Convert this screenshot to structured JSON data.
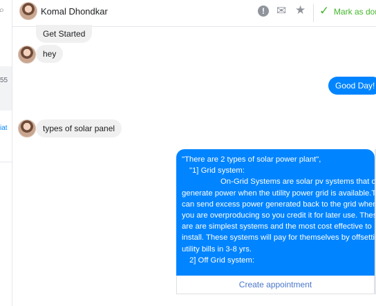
{
  "left_panel": {
    "partial_text_1": "55",
    "partial_text_2": "iat"
  },
  "header": {
    "contact_name": "Komal Dhondkar",
    "alert_icon": "alert-icon",
    "mail_icon": "envelope-icon",
    "star_icon": "star-icon",
    "mark_done_label": "Mark as dor",
    "accent_color": "#42b72a"
  },
  "messages": [
    {
      "direction": "in",
      "text": "Get Started"
    },
    {
      "direction": "in",
      "text": "hey"
    },
    {
      "direction": "out",
      "text": "Good Day!"
    },
    {
      "direction": "in",
      "text": "types of solar panel"
    }
  ],
  "solar_card": {
    "lines": [
      "\"There are 2 types of solar power plant\",",
      "\"1]   Grid system:",
      "On-Grid Systems are solar pv systems that only",
      "generate power when the utility power grid is available.They",
      "can send excess power generated back to the grid when",
      "you are overproducing so you credit it for later use. These",
      "are are simplest systems and the most cost effective to",
      "install.  These systems will pay for themselves by offsetting",
      "utility bills in 3-8 yrs.",
      "2]  Off Grid system:"
    ],
    "button_label": "Create appointment"
  },
  "colors": {
    "outgoing_bubble": "#0084ff",
    "incoming_bubble": "#f1f0f0",
    "button_text": "#4a76c9"
  }
}
